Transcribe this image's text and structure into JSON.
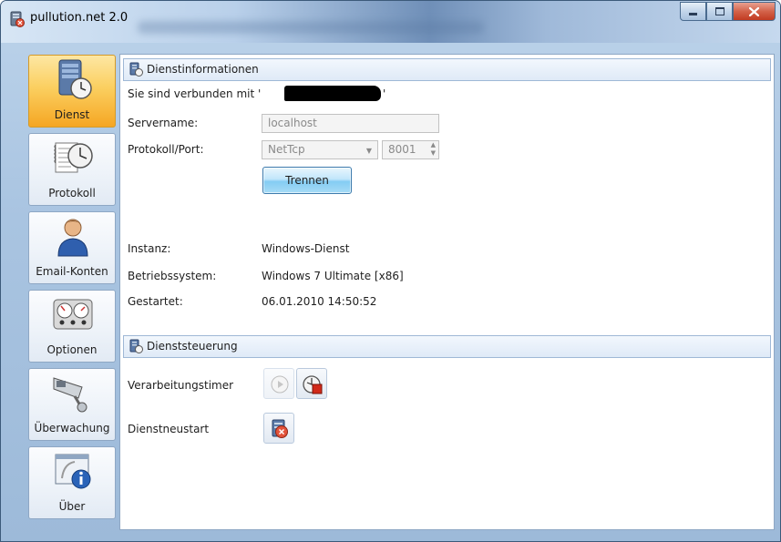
{
  "window": {
    "title": "pullution.net 2.0",
    "controls": {
      "minimize": "minimize-icon",
      "maximize": "maximize-icon",
      "close": "close-icon"
    }
  },
  "nav": {
    "items": [
      {
        "label": "Dienst",
        "icon": "server-clock-icon",
        "active": true
      },
      {
        "label": "Protokoll",
        "icon": "log-clock-icon",
        "active": false
      },
      {
        "label": "Email-Konten",
        "icon": "user-icon",
        "active": false
      },
      {
        "label": "Optionen",
        "icon": "gauges-icon",
        "active": false
      },
      {
        "label": "Überwachung",
        "icon": "camera-icon",
        "active": false
      },
      {
        "label": "Über",
        "icon": "info-window-icon",
        "active": false
      }
    ]
  },
  "dienstinfo": {
    "title": "Dienstinformationen",
    "connected_prefix": "Sie sind verbunden mit '",
    "connected_suffix": "'",
    "servername_label": "Servername:",
    "servername_value": "localhost",
    "protocol_label": "Protokoll/Port:",
    "protocol_value": "NetTcp",
    "port_value": "8001",
    "disconnect_label": "Trennen",
    "instance_label": "Instanz:",
    "instance_value": "Windows-Dienst",
    "os_label": "Betriebssystem:",
    "os_value": "Windows 7 Ultimate [x86]",
    "started_label": "Gestartet:",
    "started_value": "06.01.2010 14:50:52"
  },
  "dienststeuerung": {
    "title": "Dienststeuerung",
    "timer_label": "Verarbeitungstimer",
    "restart_label": "Dienstneustart"
  },
  "colors": {
    "active_nav": "#f5a623",
    "accent_blue": "#84ccf3",
    "close_red": "#c13b22"
  }
}
